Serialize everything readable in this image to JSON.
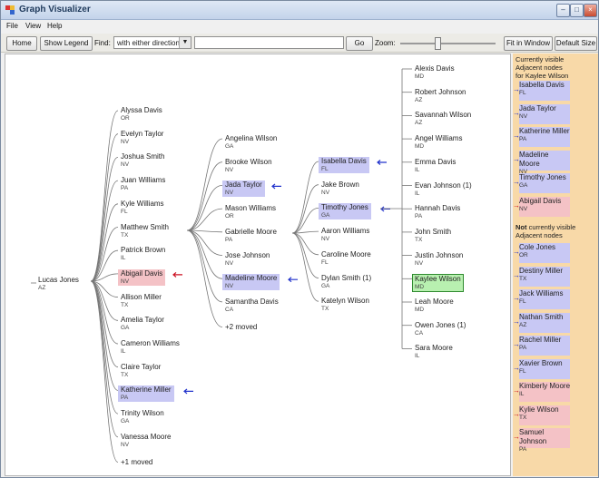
{
  "window": {
    "title": "Graph Visualizer"
  },
  "menu": [
    "File",
    "View",
    "Help"
  ],
  "toolbar": {
    "home": "Home",
    "show_legend": "Show Legend",
    "find_label": "Find:",
    "find_mode": "with either directions",
    "find_value": "",
    "go": "Go",
    "zoom_label": "Zoom:",
    "fit_in_window": "Fit in Window",
    "default_size": "Default Size"
  },
  "graph": {
    "root": {
      "name": "Lucas Jones",
      "state": "AZ"
    },
    "col1": [
      {
        "name": "Alyssa Davis",
        "state": "OR"
      },
      {
        "name": "Evelyn Taylor",
        "state": "NV"
      },
      {
        "name": "Joshua Smith",
        "state": "NV"
      },
      {
        "name": "Juan Williams",
        "state": "PA"
      },
      {
        "name": "Kyle Williams",
        "state": "FL"
      },
      {
        "name": "Matthew Smith",
        "state": "TX"
      },
      {
        "name": "Patrick Brown",
        "state": "IL"
      },
      {
        "name": "Abigail Davis",
        "state": "NV",
        "hl": "pink"
      },
      {
        "name": "Allison Miller",
        "state": "TX"
      },
      {
        "name": "Amelia Taylor",
        "state": "GA"
      },
      {
        "name": "Cameron Williams",
        "state": "IL"
      },
      {
        "name": "Claire Taylor",
        "state": "TX"
      },
      {
        "name": "Katherine Miller",
        "state": "PA",
        "hl": "blue"
      },
      {
        "name": "Trinity Wilson",
        "state": "GA"
      },
      {
        "name": "Vanessa Moore",
        "state": "NV"
      }
    ],
    "col1_moved": "+1 moved",
    "col2": [
      {
        "name": "Angelina Wilson",
        "state": "GA"
      },
      {
        "name": "Brooke Wilson",
        "state": "NV"
      },
      {
        "name": "Jada Taylor",
        "state": "NV",
        "hl": "blue"
      },
      {
        "name": "Mason Williams",
        "state": "OR"
      },
      {
        "name": "Gabrielle Moore",
        "state": "PA"
      },
      {
        "name": "Jose Johnson",
        "state": "NV"
      },
      {
        "name": "Madeline Moore",
        "state": "NV",
        "hl": "blue"
      },
      {
        "name": "Samantha Davis",
        "state": "CA"
      }
    ],
    "col2_moved": "+2 moved",
    "col3": [
      {
        "name": "Isabella Davis",
        "state": "FL",
        "hl": "blue"
      },
      {
        "name": "Jake Brown",
        "state": "NV"
      },
      {
        "name": "Timothy Jones",
        "state": "GA",
        "hl": "blue"
      },
      {
        "name": "Aaron Williams",
        "state": "NV"
      },
      {
        "name": "Caroline Moore",
        "state": "FL"
      },
      {
        "name": "Dylan Smith (1)",
        "state": "GA"
      },
      {
        "name": "Katelyn Wilson",
        "state": "TX"
      }
    ],
    "col4": [
      {
        "name": "Alexis Davis",
        "state": "MD"
      },
      {
        "name": "Robert Johnson",
        "state": "AZ"
      },
      {
        "name": "Savannah Wilson",
        "state": "AZ"
      },
      {
        "name": "Angel Williams",
        "state": "MD"
      },
      {
        "name": "Emma Davis",
        "state": "IL"
      },
      {
        "name": "Evan Johnson (1)",
        "state": "IL"
      },
      {
        "name": "Hannah Davis",
        "state": "PA"
      },
      {
        "name": "John Smith",
        "state": "TX"
      },
      {
        "name": "Justin Johnson",
        "state": "NV"
      },
      {
        "name": "Kaylee Wilson",
        "state": "MD",
        "hl": "sel"
      },
      {
        "name": "Leah Moore",
        "state": "MD"
      },
      {
        "name": "Owen Jones (1)",
        "state": "CA"
      },
      {
        "name": "Sara Moore",
        "state": "IL"
      }
    ]
  },
  "sidepanel": {
    "visible_header_lines": [
      "Currently visible",
      "Adjacent nodes",
      "for Kaylee Wilson"
    ],
    "visible": [
      {
        "name": "Isabella Davis",
        "state": "FL",
        "hl": "blue"
      },
      {
        "name": "Jada Taylor",
        "state": "NV",
        "hl": "blue"
      },
      {
        "name": "Katherine Miller",
        "state": "PA",
        "hl": "blue"
      },
      {
        "name": "Madeline Moore",
        "state": "NV",
        "hl": "blue"
      },
      {
        "name": "Timothy Jones",
        "state": "GA",
        "hl": "blue"
      },
      {
        "name": "Abigail Davis",
        "state": "NV",
        "hl": "pink"
      }
    ],
    "not_visible_header_bold": "Not",
    "not_visible_header_rest": " currently visible",
    "not_visible_header_line2": "Adjacent nodes",
    "not_visible": [
      {
        "name": "Cole Jones",
        "state": "OR",
        "hl": "blue"
      },
      {
        "name": "Destiny Miller",
        "state": "TX",
        "hl": "blue"
      },
      {
        "name": "Jack Williams",
        "state": "FL",
        "hl": "blue"
      },
      {
        "name": "Nathan Smith",
        "state": "AZ",
        "hl": "blue"
      },
      {
        "name": "Rachel Miller",
        "state": "PA",
        "hl": "blue"
      },
      {
        "name": "Xavier Brown",
        "state": "FL",
        "hl": "blue"
      },
      {
        "name": "Kimberly Moore",
        "state": "IL",
        "hl": "pink"
      },
      {
        "name": "Kylie Wilson",
        "state": "TX",
        "hl": "pink"
      },
      {
        "name": "Samuel Johnson",
        "state": "PA",
        "hl": "pink"
      }
    ]
  },
  "colors": {
    "blue": "#c8c8f4",
    "pink": "#f4c2c6",
    "selected": "#b8f0b0",
    "arrow_blue": "#2233cc",
    "arrow_red": "#cc1122",
    "panel": "#f8d9a8"
  }
}
